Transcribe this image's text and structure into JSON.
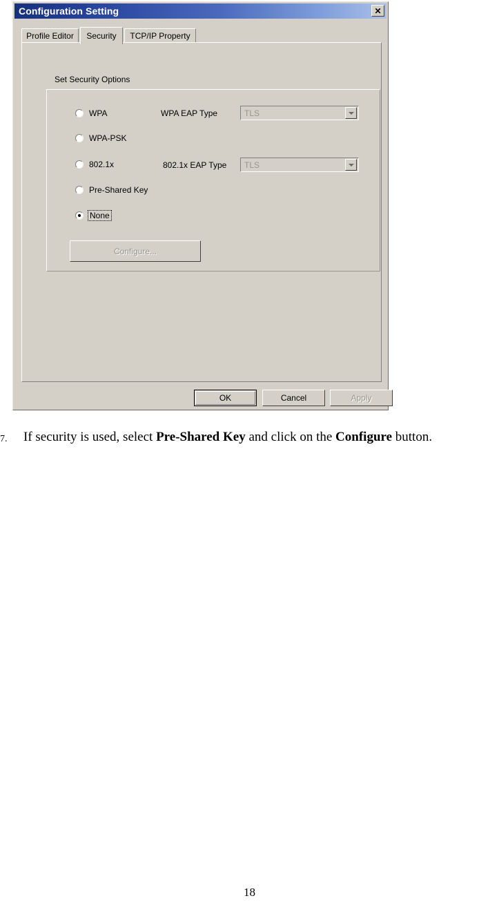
{
  "dialog": {
    "title": "Configuration Setting",
    "close_icon": "close-icon",
    "tabs": [
      {
        "label": "Profile Editor",
        "active": false
      },
      {
        "label": "Security",
        "active": true
      },
      {
        "label": "TCP/IP Property",
        "active": false
      }
    ],
    "group": {
      "label": "Set Security Options",
      "options": [
        {
          "label": "WPA",
          "selected": false,
          "focused": false
        },
        {
          "label": "WPA-PSK",
          "selected": false,
          "focused": false
        },
        {
          "label": "802.1x",
          "selected": false,
          "focused": false
        },
        {
          "label": "Pre-Shared Key",
          "selected": false,
          "focused": false
        },
        {
          "label": "None",
          "selected": true,
          "focused": true
        }
      ],
      "wpa_eap_type_label": "WPA EAP Type",
      "wpa_eap_type_value": "TLS",
      "dot1x_eap_type_label": "802.1x EAP Type",
      "dot1x_eap_type_value": "TLS",
      "configure_label": "Configure...",
      "configure_disabled": true
    },
    "buttons": {
      "ok": "OK",
      "cancel": "Cancel",
      "apply": "Apply",
      "apply_disabled": true
    }
  },
  "document": {
    "step_number": "7.",
    "caption_part1": "If security is used, select ",
    "caption_bold1": "Pre-Shared Key",
    "caption_part2": " and click on the ",
    "caption_bold2": "Configure",
    "caption_part3": " button.",
    "page_number": "18"
  }
}
